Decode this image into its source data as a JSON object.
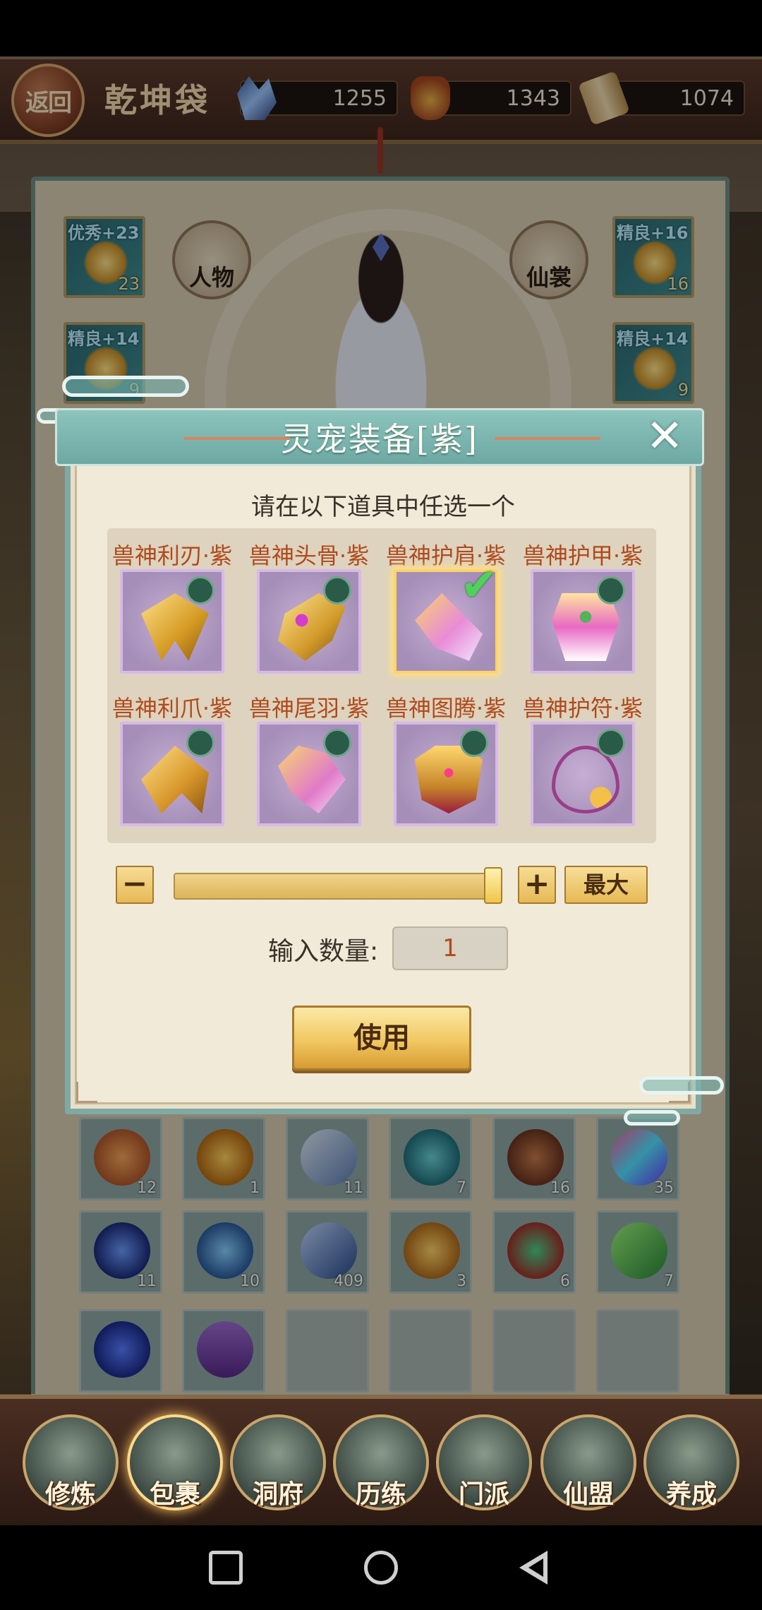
{
  "top_bar": {
    "back_label": "返回",
    "title": "乾坤袋",
    "resources": [
      {
        "icon": "crystal-icon",
        "value": "1255"
      },
      {
        "icon": "pouch-icon",
        "value": "1343"
      },
      {
        "icon": "scroll-icon",
        "value": "1074"
      }
    ]
  },
  "character_panel": {
    "tabs": {
      "character": "人物",
      "costume": "仙裳"
    },
    "gear_left": [
      {
        "quality": "优秀+23",
        "count": "23"
      },
      {
        "quality": "精良+14",
        "count": "9"
      }
    ],
    "gear_right": [
      {
        "quality": "精良+16",
        "count": "16"
      },
      {
        "quality": "精良+14",
        "count": "9"
      }
    ]
  },
  "dialog": {
    "title": "灵宠装备[紫]",
    "close_label": "✕",
    "prompt": "请在以下道具中任选一个",
    "items": [
      {
        "name": "兽神利刃·紫",
        "art": "blade-icon",
        "selected": false
      },
      {
        "name": "兽神头骨·紫",
        "art": "skull-icon",
        "selected": false
      },
      {
        "name": "兽神护肩·紫",
        "art": "shoulder-guard-icon",
        "selected": true
      },
      {
        "name": "兽神护甲·紫",
        "art": "armor-icon",
        "selected": false
      },
      {
        "name": "兽神利爪·紫",
        "art": "claw-icon",
        "selected": false
      },
      {
        "name": "兽神尾羽·紫",
        "art": "tail-feather-icon",
        "selected": false
      },
      {
        "name": "兽神图腾·紫",
        "art": "totem-icon",
        "selected": false
      },
      {
        "name": "兽神护符·紫",
        "art": "amulet-icon",
        "selected": false
      }
    ],
    "minus_label": "−",
    "plus_label": "+",
    "max_label": "最大",
    "slider_fraction": 1.0,
    "quantity_label": "输入数量:",
    "quantity_value": "1",
    "use_label": "使用"
  },
  "inventory": {
    "rows": [
      [
        {
          "count": "12"
        },
        {
          "count": "1"
        },
        {
          "count": "11"
        },
        {
          "count": "7"
        },
        {
          "count": "16"
        },
        {
          "count": "35"
        }
      ],
      [
        {
          "count": "11"
        },
        {
          "count": "10"
        },
        {
          "count": "409"
        },
        {
          "count": "3"
        },
        {
          "count": "6"
        },
        {
          "count": "7"
        }
      ],
      [
        {
          "count": ""
        },
        {
          "count": ""
        },
        {
          "count": ""
        },
        {
          "count": ""
        },
        {
          "count": ""
        },
        {
          "count": ""
        }
      ]
    ]
  },
  "bottom_nav": [
    {
      "label": "修炼",
      "active": false
    },
    {
      "label": "包裹",
      "active": true
    },
    {
      "label": "洞府",
      "active": false
    },
    {
      "label": "历练",
      "active": false
    },
    {
      "label": "门派",
      "active": false
    },
    {
      "label": "仙盟",
      "active": false
    },
    {
      "label": "养成",
      "active": false
    }
  ],
  "colors": {
    "dialog_teal": "#7ea9a4",
    "item_name": "#b04a1c",
    "selected_border": "#ffd36a",
    "check_green": "#4ed25a"
  }
}
